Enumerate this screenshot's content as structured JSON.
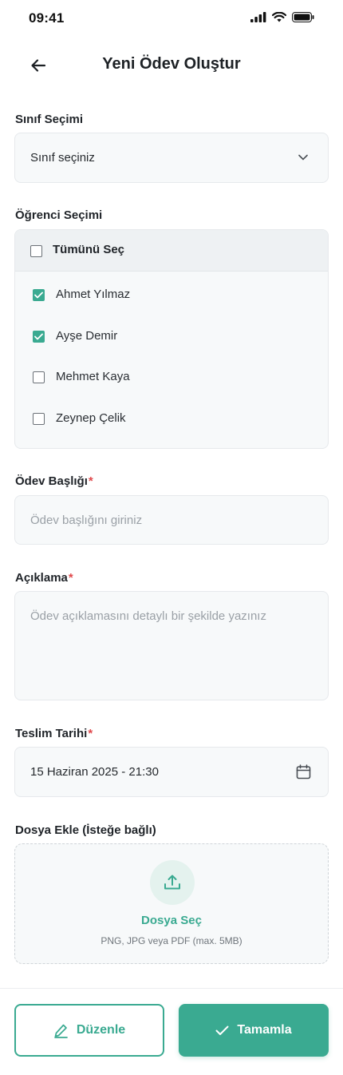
{
  "status_bar": {
    "time": "09:41"
  },
  "header": {
    "title": "Yeni Ödev Oluştur",
    "back_icon": "arrow-left-icon"
  },
  "class_selection": {
    "label": "Sınıf Seçimi",
    "value": "Sınıf seçiniz"
  },
  "student_selection": {
    "label": "Öğrenci Seçimi",
    "select_all_label": "Tümünü Seç",
    "select_all_checked": false,
    "students": [
      {
        "name": "Ahmet Yılmaz",
        "checked": true
      },
      {
        "name": "Ayşe Demir",
        "checked": true
      },
      {
        "name": "Mehmet Kaya",
        "checked": false
      },
      {
        "name": "Zeynep Çelik",
        "checked": false
      }
    ]
  },
  "title_field": {
    "label": "Ödev Başlığı",
    "required_mark": "*",
    "placeholder": "Ödev başlığını giriniz"
  },
  "description_field": {
    "label": "Açıklama",
    "required_mark": "*",
    "placeholder": "Ödev açıklamasını detaylı bir şekilde yazınız"
  },
  "due_date": {
    "label": "Teslim Tarihi",
    "required_mark": "*",
    "value": "15 Haziran 2025 - 21:30"
  },
  "attachment": {
    "label": "Dosya Ekle (İsteğe bağlı)",
    "button_label": "Dosya Seç",
    "hint": "PNG, JPG veya PDF (max. 5MB)"
  },
  "footer": {
    "edit_label": "Düzenle",
    "done_label": "Tamamla"
  },
  "colors": {
    "accent": "#3aaa91",
    "required": "#e0484b",
    "field_bg": "#f7f9fa"
  }
}
